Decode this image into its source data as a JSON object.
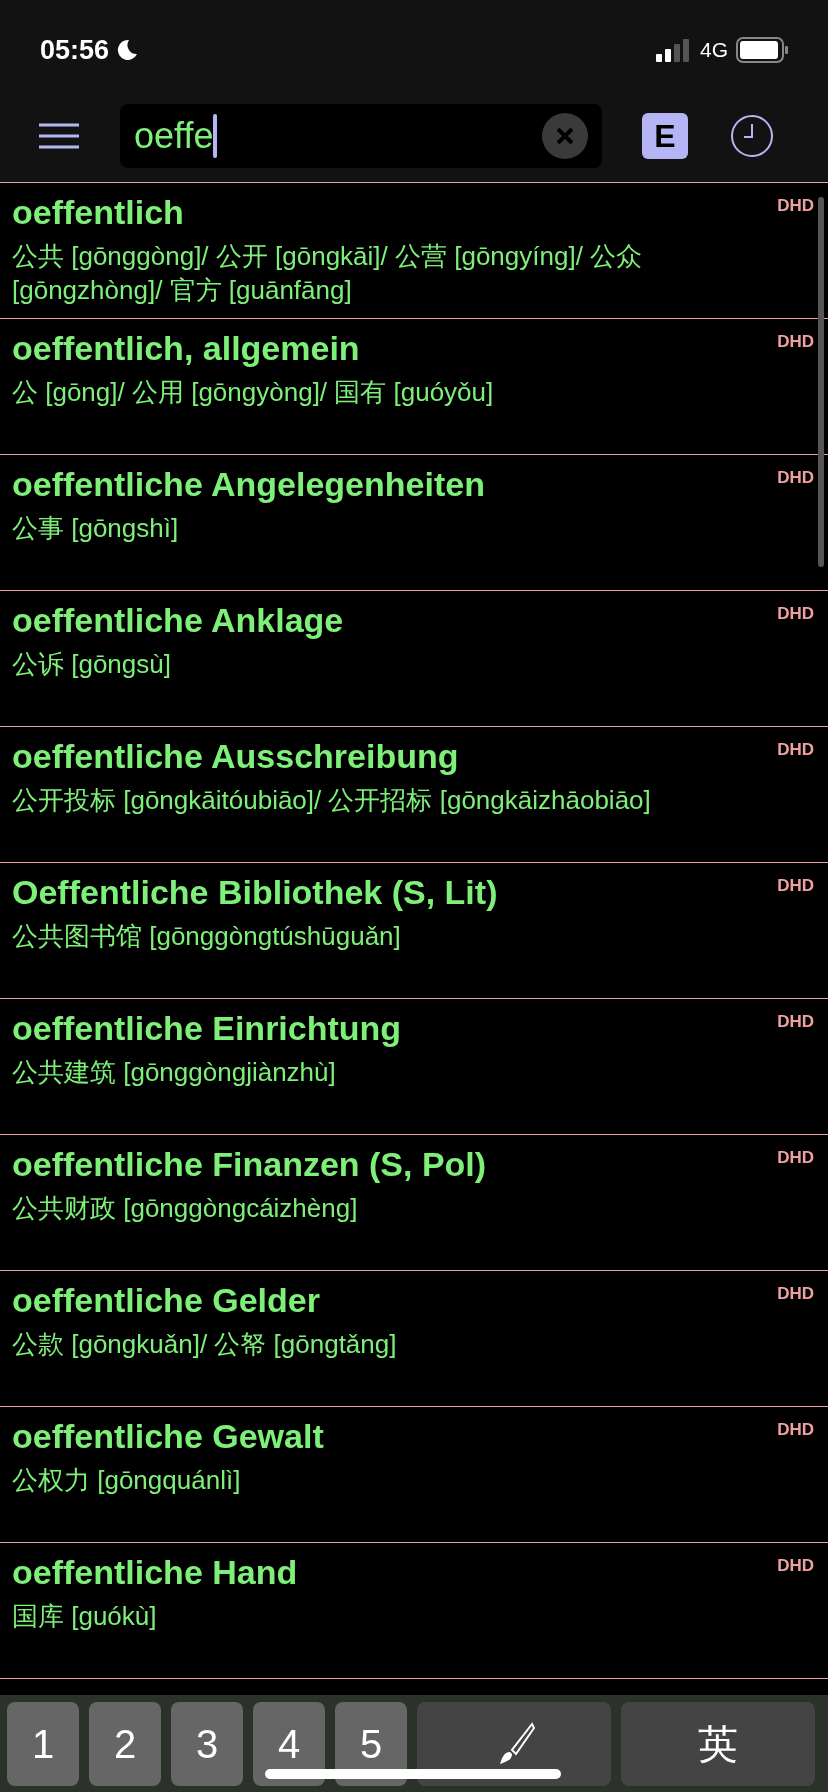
{
  "status_bar": {
    "time": "05:56",
    "network": "4G"
  },
  "search": {
    "value": "oeffe",
    "mode_button": "E"
  },
  "results": [
    {
      "headword": "oeffentlich",
      "gloss": "公共 [gōnggòng]/ 公开 [gōngkāi]/ 公营 [gōngyíng]/ 公众 [gōngzhòng]/ 官方 [guānfāng]",
      "source": "DHD"
    },
    {
      "headword": "oeffentlich, allgemein",
      "gloss": "公 [gōng]/ 公用 [gōngyòng]/ 国有 [guóyǒu]",
      "source": "DHD"
    },
    {
      "headword": "oeffentliche Angelegenheiten",
      "gloss": "公事 [gōngshì]",
      "source": "DHD"
    },
    {
      "headword": "oeffentliche Anklage",
      "gloss": "公诉 [gōngsù]",
      "source": "DHD"
    },
    {
      "headword": "oeffentliche Ausschreibung",
      "gloss": "公开投标 [gōngkāitóubiāo]/ 公开招标 [gōngkāizhāobiāo]",
      "source": "DHD"
    },
    {
      "headword": "Oeffentliche Bibliothek (S, Lit)",
      "gloss": "公共图书馆 [gōnggòngtúshūguǎn]",
      "source": "DHD"
    },
    {
      "headword": "oeffentliche Einrichtung",
      "gloss": "公共建筑 [gōnggòngjiànzhù]",
      "source": "DHD"
    },
    {
      "headword": "oeffentliche Finanzen (S, Pol)",
      "gloss": "公共财政 [gōnggòngcáizhèng]",
      "source": "DHD"
    },
    {
      "headword": "oeffentliche Gelder",
      "gloss": "公款 [gōngkuǎn]/ 公帑 [gōngtǎng]",
      "source": "DHD"
    },
    {
      "headword": "oeffentliche Gewalt",
      "gloss": "公权力 [gōngquánlì]",
      "source": "DHD"
    },
    {
      "headword": "oeffentliche Hand",
      "gloss": "国库 [guókù]",
      "source": "DHD"
    }
  ],
  "keyboard": {
    "number_keys": [
      "1",
      "2",
      "3",
      "4",
      "5"
    ],
    "language_key": "英"
  }
}
